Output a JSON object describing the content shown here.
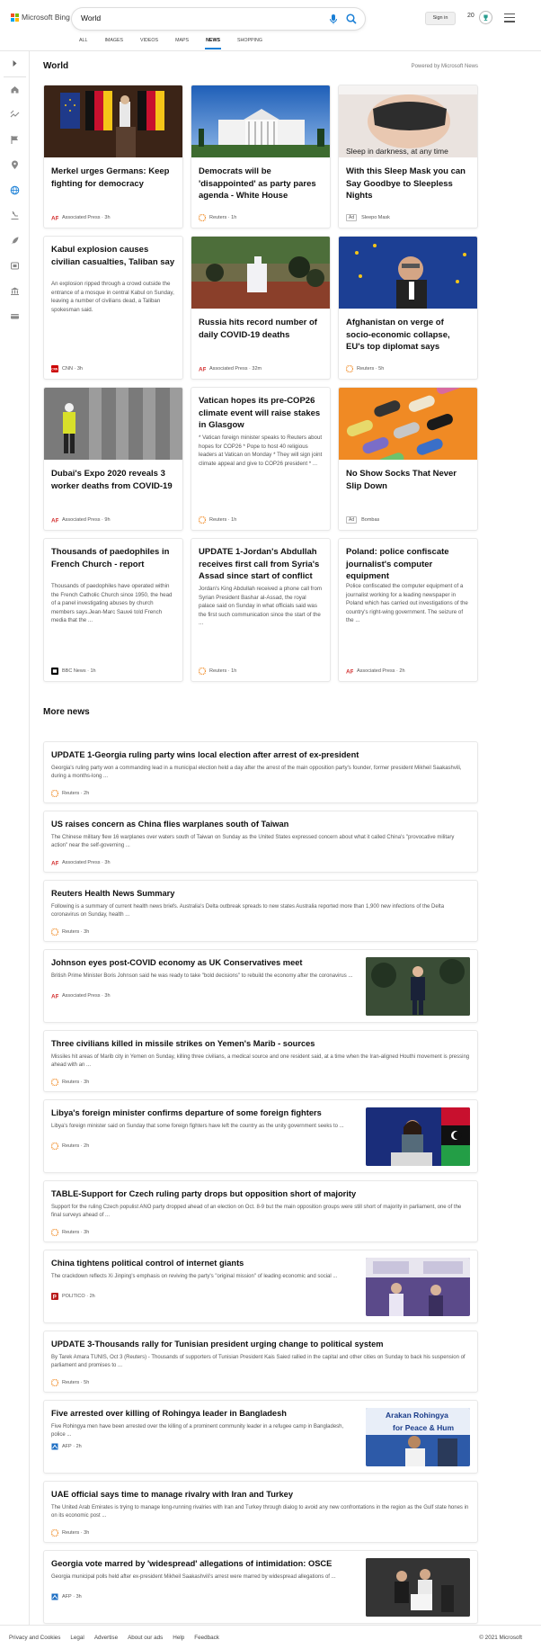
{
  "header": {
    "brand": "Microsoft Bing",
    "search_value": "World",
    "sign_in": "Sign in",
    "points": "20",
    "logo_colors": [
      "#f25022",
      "#7fba00",
      "#00a4ef",
      "#ffb900"
    ]
  },
  "tabs": [
    {
      "label": "ALL"
    },
    {
      "label": "IMAGES"
    },
    {
      "label": "VIDEOS"
    },
    {
      "label": "MAPS"
    },
    {
      "label": "NEWS",
      "active": true
    },
    {
      "label": "SHOPPING"
    }
  ],
  "rail_icons": [
    "expand-icon",
    "home-icon",
    "trending-icon",
    "flag-icon",
    "location-icon",
    "globe-icon",
    "science-icon",
    "rocket-icon",
    "entertainment-icon",
    "politics-icon",
    "money-icon"
  ],
  "world": {
    "title": "World",
    "powered_by": "Powered by Microsoft News",
    "cards": [
      {
        "title": "Merkel urges Germans: Keep fighting for democracy",
        "source": "Associated Press",
        "time": "3h",
        "logo": "AP"
      },
      {
        "title": "Democrats will be 'disappointed' as party pares agenda - White House",
        "source": "Reuters",
        "time": "1h",
        "logo": "R"
      },
      {
        "title": "With this Sleep Mask you can Say Goodbye to Sleepless Nights",
        "source": "Sleepo Mask",
        "ad": "Ad",
        "image_text": "Sleep in darkness, at any time"
      },
      {
        "title": "Kabul explosion causes civilian casualties, Taliban say",
        "snippet": "An explosion ripped through a crowd outside the entrance of a mosque in central Kabul on Sunday, leaving a number of civilians dead, a Taliban spokesman said.",
        "source": "CNN",
        "time": "3h",
        "logo": "CNN"
      },
      {
        "title": "Russia hits record number of daily COVID-19 deaths",
        "source": "Associated Press",
        "time": "32m",
        "logo": "AP"
      },
      {
        "title": "Afghanistan on verge of socio-economic collapse, EU's top diplomat says",
        "source": "Reuters",
        "time": "5h",
        "logo": "R"
      },
      {
        "title": "Dubai's Expo 2020 reveals 3 worker deaths from COVID-19",
        "source": "Associated Press",
        "time": "9h",
        "logo": "AP"
      },
      {
        "title": "Vatican hopes its pre-COP26 climate event will raise stakes in Glasgow",
        "snippet": "* Vatican foreign minister speaks to Reuters about hopes for COP26 * Pope to host 40 religious leaders at Vatican on Monday * They will sign joint climate appeal and give to COP26 president * ...",
        "source": "Reuters",
        "time": "1h",
        "logo": "R"
      },
      {
        "title": "No Show Socks That Never Slip Down",
        "source": "Bombas",
        "ad": "Ad"
      },
      {
        "title": "Thousands of paedophiles in French Church - report",
        "snippet": "Thousands of paedophiles have operated within the French Catholic Church since 1950, the head of a panel investigating abuses by church members says.Jean-Marc Sauvé told French media that the ...",
        "source": "BBC News",
        "time": "1h",
        "logo": "B"
      },
      {
        "title": "UPDATE 1-Jordan's Abdullah receives first call from Syria's Assad since start of conflict",
        "snippet": "Jordan's King Abdullah received a phone call from Syrian President Bashar al-Assad, the royal palace said on Sunday in what officials said was the first such communication since the start of the ...",
        "source": "Reuters",
        "time": "1h",
        "logo": "R"
      },
      {
        "title": "Poland: police confiscate journalist's computer equipment",
        "snippet": "Police confiscated the computer equipment of a journalist working for a leading newspaper in Poland which has carried out investigations of the country's right-wing government. The seizure of the ...",
        "source": "Associated Press",
        "time": "2h",
        "logo": "AP"
      }
    ]
  },
  "more_news": {
    "title": "More news",
    "items": [
      {
        "title": "UPDATE 1-Georgia ruling party wins local election after arrest of ex-president",
        "snippet": "Georgia's ruling party won a commanding lead in a municipal election held a day after the arrest of the main opposition party's founder, former president Mikheil Saakashvili, during a months-long ...",
        "source": "Reuters",
        "time": "2h",
        "logo": "R"
      },
      {
        "title": "US raises concern as China flies warplanes south of Taiwan",
        "snippet": "The Chinese military flew 16 warplanes over waters south of Taiwan on Sunday as the United States expressed concern about what it called China's \"provocative military action\" near the self-governing ...",
        "source": "Associated Press",
        "time": "3h",
        "logo": "AP"
      },
      {
        "title": "Reuters Health News Summary",
        "snippet": "Following is a summary of current health news briefs. Australia's Delta outbreak spreads to new states Australia reported more than 1,900 new infections of the Delta coronavirus on Sunday, health ...",
        "source": "Reuters",
        "time": "3h",
        "logo": "R"
      },
      {
        "title": "Johnson eyes post-COVID economy as UK Conservatives meet",
        "snippet": "British Prime Minister Boris Johnson said he was ready to take \"bold decisions\" to rebuild the economy after the coronavirus ...",
        "source": "Associated Press",
        "time": "3h",
        "logo": "AP",
        "thumb": "johnson"
      },
      {
        "title": "Three civilians killed in missile strikes on Yemen's Marib - sources",
        "snippet": "Missiles hit areas of Marib city in Yemen on Sunday, killing three civilians, a medical source and one resident said, at a time when the Iran-aligned Houthi movement is pressing ahead with an ...",
        "source": "Reuters",
        "time": "3h",
        "logo": "R"
      },
      {
        "title": "Libya's foreign minister confirms departure of some foreign fighters",
        "snippet": "Libya's foreign minister said on Sunday that some foreign fighters have left the country as the unity government seeks to ...",
        "source": "Reuters",
        "time": "2h",
        "logo": "R",
        "thumb": "libya"
      },
      {
        "title": "TABLE-Support for Czech ruling party drops but opposition short of majority",
        "snippet": "Support for the ruling Czech populist ANO party dropped ahead of an election on Oct. 8-9 but the main opposition groups were still short of majority in parliament, one of the final surveys ahead of ...",
        "source": "Reuters",
        "time": "3h",
        "logo": "R"
      },
      {
        "title": "China tightens political control of internet giants",
        "snippet": "The crackdown reflects Xi Jinping's emphasis on reviving the party's \"original mission\" of leading economic and social ...",
        "source": "POLITICO",
        "time": "2h",
        "logo": "P",
        "thumb": "china"
      },
      {
        "title": "UPDATE 3-Thousands rally for Tunisian president urging change to political system",
        "snippet": "By Tarek Amara TUNIS, Oct 3 (Reuters) - Thousands of supporters of Tunisian President Kais Saied rallied in the capital and other cities on Sunday to back his suspension of parliament and promises to ...",
        "source": "Reuters",
        "time": "5h",
        "logo": "R"
      },
      {
        "title": "Five arrested over killing of Rohingya leader in Bangladesh",
        "snippet": "Five Rohingya men have been arrested over the killing of a prominent community leader in a refugee camp in Bangladesh, police ...",
        "source": "AFP",
        "time": "2h",
        "logo": "AFP",
        "thumb": "rohingya",
        "thumb_text_1": "Arakan Rohingya",
        "thumb_text_2": "for Peace & Hum"
      },
      {
        "title": "UAE official says time to manage rivalry with Iran and Turkey",
        "snippet": "The United Arab Emirates is trying to manage long-running rivalries with Iran and Turkey through dialog to avoid any new confrontations in the region as the Gulf state hones in on its economic post ...",
        "source": "Reuters",
        "time": "3h",
        "logo": "R"
      },
      {
        "title": "Georgia vote marred by 'widespread' allegations of intimidation: OSCE",
        "snippet": "Georgia municipal polls held after ex-president Mikheil Saakashvili's arrest were marred by widespread allegations of ...",
        "source": "AFP",
        "time": "3h",
        "logo": "AFP",
        "thumb": "georgia"
      }
    ]
  },
  "footer": {
    "links": [
      "Privacy and Cookies",
      "Legal",
      "Advertise",
      "About our ads",
      "Help",
      "Feedback"
    ],
    "copyright": "© 2021 Microsoft"
  },
  "colors": {
    "accent": "#1a7fd6",
    "ap": "#d32f2f",
    "reuters": "#f08a24",
    "cnn": "#cc0000",
    "bbc": "#000000",
    "politico": "#b91c1c",
    "afp": "#1e6fc4"
  }
}
